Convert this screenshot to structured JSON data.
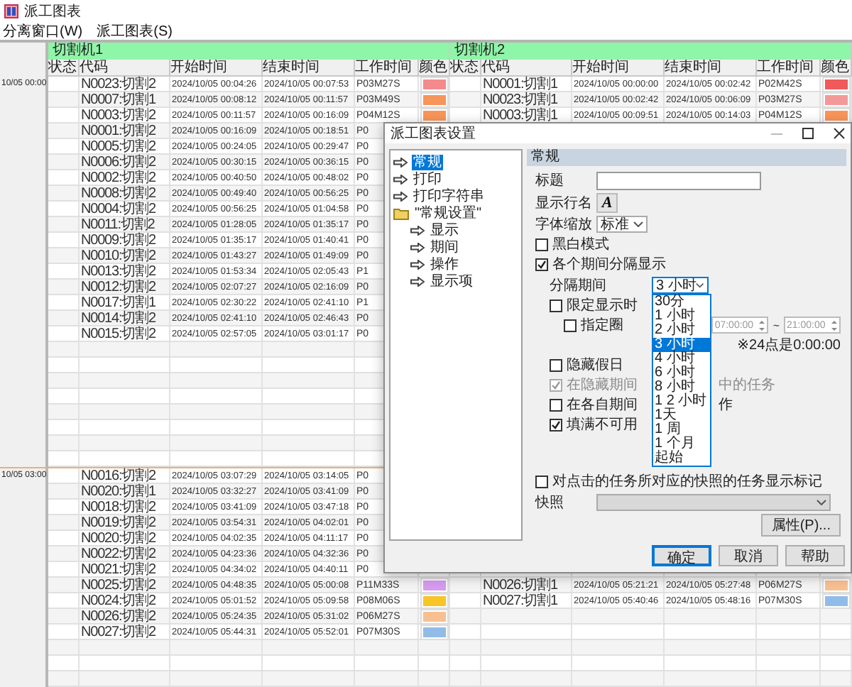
{
  "window": {
    "title": "派工图表"
  },
  "menu": [
    "分离窗口(W)",
    "派工图表(S)"
  ],
  "groups": [
    {
      "title": "切割机1",
      "columns": [
        "状态",
        "代码",
        "开始时间",
        "结束时间",
        "工作时间",
        "颜色"
      ]
    },
    {
      "title": "切割机2",
      "columns": [
        "状态",
        "代码",
        "开始时间",
        "结束时间",
        "工作时间",
        "颜色"
      ]
    }
  ],
  "sections": [
    {
      "time": "10/05 00:00",
      "rows": [
        {
          "left": {
            "code": "N0023:切割2",
            "start": "2024/10/05 00:04:26",
            "end": "2024/10/05 00:07:53",
            "duration": "P03M27S",
            "color": "#f48a8c"
          },
          "right": {
            "code": "N0001:切割1",
            "start": "2024/10/05 00:00:00",
            "end": "2024/10/05 00:02:42",
            "duration": "P02M42S",
            "color": "#f05a5a"
          }
        },
        {
          "left": {
            "code": "N0007:切割1",
            "start": "2024/10/05 00:08:12",
            "end": "2024/10/05 00:11:57",
            "duration": "P03M49S",
            "color": "#f8955a"
          },
          "right": {
            "code": "N0023:切割1",
            "start": "2024/10/05 00:02:42",
            "end": "2024/10/05 00:06:09",
            "duration": "P03M27S",
            "color": "#f4999a"
          }
        },
        {
          "left": {
            "code": "N0003:切割2",
            "start": "2024/10/05 00:11:57",
            "end": "2024/10/05 00:16:09",
            "duration": "P04M12S",
            "color": "#f8955a"
          },
          "right": {
            "code": "N0003:切割1",
            "start": "2024/10/05 00:09:51",
            "end": "2024/10/05 00:14:03",
            "duration": "P04M12S",
            "color": "#f8955a"
          }
        },
        {
          "left": {
            "code": "N0001:切割2",
            "start": "2024/10/05 00:16:09",
            "end": "2024/10/05 00:18:51",
            "duration": "P0"
          }
        },
        {
          "left": {
            "code": "N0005:切割2",
            "start": "2024/10/05 00:24:05",
            "end": "2024/10/05 00:29:47",
            "duration": "P0"
          }
        },
        {
          "left": {
            "code": "N0006:切割2",
            "start": "2024/10/05 00:30:15",
            "end": "2024/10/05 00:36:15",
            "duration": "P0"
          }
        },
        {
          "left": {
            "code": "N0002:切割2",
            "start": "2024/10/05 00:40:50",
            "end": "2024/10/05 00:48:02",
            "duration": "P0"
          }
        },
        {
          "left": {
            "code": "N0008:切割2",
            "start": "2024/10/05 00:49:40",
            "end": "2024/10/05 00:56:25",
            "duration": "P0"
          }
        },
        {
          "left": {
            "code": "N0004:切割2",
            "start": "2024/10/05 00:56:25",
            "end": "2024/10/05 01:04:58",
            "duration": "P0"
          }
        },
        {
          "left": {
            "code": "N0011:切割2",
            "start": "2024/10/05 01:28:05",
            "end": "2024/10/05 01:35:17",
            "duration": "P0"
          }
        },
        {
          "left": {
            "code": "N0009:切割2",
            "start": "2024/10/05 01:35:17",
            "end": "2024/10/05 01:40:41",
            "duration": "P0"
          }
        },
        {
          "left": {
            "code": "N0010:切割2",
            "start": "2024/10/05 01:43:27",
            "end": "2024/10/05 01:49:09",
            "duration": "P0"
          }
        },
        {
          "left": {
            "code": "N0013:切割2",
            "start": "2024/10/05 01:53:34",
            "end": "2024/10/05 02:05:43",
            "duration": "P1"
          }
        },
        {
          "left": {
            "code": "N0012:切割2",
            "start": "2024/10/05 02:07:27",
            "end": "2024/10/05 02:16:09",
            "duration": "P0"
          }
        },
        {
          "left": {
            "code": "N0017:切割1",
            "start": "2024/10/05 02:30:22",
            "end": "2024/10/05 02:41:10",
            "duration": "P1"
          }
        },
        {
          "left": {
            "code": "N0014:切割2",
            "start": "2024/10/05 02:41:10",
            "end": "2024/10/05 02:46:43",
            "duration": "P0"
          }
        },
        {
          "left": {
            "code": "N0015:切割2",
            "start": "2024/10/05 02:57:05",
            "end": "2024/10/05 03:01:17",
            "duration": "P0"
          }
        }
      ]
    },
    {
      "time": "10/05 03:00",
      "rows": [
        {
          "left": {
            "code": "N0016:切割2",
            "start": "2024/10/05 03:07:29",
            "end": "2024/10/05 03:14:05",
            "duration": "P0"
          }
        },
        {
          "left": {
            "code": "N0020:切割1",
            "start": "2024/10/05 03:32:27",
            "end": "2024/10/05 03:41:09",
            "duration": "P0"
          }
        },
        {
          "left": {
            "code": "N0018:切割2",
            "start": "2024/10/05 03:41:09",
            "end": "2024/10/05 03:47:18",
            "duration": "P0"
          }
        },
        {
          "left": {
            "code": "N0019:切割2",
            "start": "2024/10/05 03:54:31",
            "end": "2024/10/05 04:02:01",
            "duration": "P0"
          }
        },
        {
          "left": {
            "code": "N0020:切割2",
            "start": "2024/10/05 04:02:35",
            "end": "2024/10/05 04:11:17",
            "duration": "P0"
          }
        },
        {
          "left": {
            "code": "N0022:切割2",
            "start": "2024/10/05 04:23:36",
            "end": "2024/10/05 04:32:36",
            "duration": "P0"
          }
        },
        {
          "left": {
            "code": "N0021:切割2",
            "start": "2024/10/05 04:34:02",
            "end": "2024/10/05 04:40:11",
            "duration": "P0"
          }
        },
        {
          "left": {
            "code": "N0025:切割2",
            "start": "2024/10/05 04:48:35",
            "end": "2024/10/05 05:00:08",
            "duration": "P11M33S",
            "color": "#d69cf0"
          },
          "right": {
            "code": "N0026:切割1",
            "start": "2024/10/05 05:21:21",
            "end": "2024/10/05 05:27:48",
            "duration": "P06M27S",
            "color": "#f8c092"
          }
        },
        {
          "left": {
            "code": "N0024:切割2",
            "start": "2024/10/05 05:01:52",
            "end": "2024/10/05 05:09:58",
            "duration": "P08M06S",
            "color": "#f8c428"
          },
          "right": {
            "code": "N0027:切割1",
            "start": "2024/10/05 05:40:46",
            "end": "2024/10/05 05:48:16",
            "duration": "P07M30S",
            "color": "#92bce8"
          }
        },
        {
          "left": {
            "code": "N0026:切割2",
            "start": "2024/10/05 05:24:35",
            "end": "2024/10/05 05:31:02",
            "duration": "P06M27S",
            "color": "#f8c092"
          }
        },
        {
          "left": {
            "code": "N0027:切割2",
            "start": "2024/10/05 05:44:31",
            "end": "2024/10/05 05:52:01",
            "duration": "P07M30S",
            "color": "#92bce8"
          }
        }
      ]
    }
  ],
  "dialog": {
    "title": "派工图表设置",
    "tree": [
      {
        "label": "常规",
        "selected": true
      },
      {
        "label": "打印",
        "selected": false
      },
      {
        "label": "打印字符串",
        "selected": false
      },
      {
        "label": "\"常规设置\"",
        "selected": false,
        "children": [
          {
            "label": "显示",
            "selected": false
          },
          {
            "label": "期间",
            "selected": false
          },
          {
            "label": "操作",
            "selected": false
          },
          {
            "label": "显示项",
            "selected": false
          }
        ]
      }
    ],
    "section_title": "常规",
    "title_field": {
      "label": "标题"
    },
    "row_name": {
      "label": "显示行名",
      "button": "A"
    },
    "font_scale": {
      "label": "字体缩放",
      "value": "标准"
    },
    "mono_mode": {
      "label": "黑白模式",
      "checked": false
    },
    "split_display": {
      "label": "各个期间分隔显示",
      "checked": true
    },
    "split_period": {
      "label": "分隔期间",
      "value": "3 小时",
      "expanded": true,
      "options": [
        {
          "label": "30分",
          "selected": false
        },
        {
          "label": "1 小时",
          "selected": false
        },
        {
          "label": "2 小时",
          "selected": false
        },
        {
          "label": "3 小时",
          "selected": true
        },
        {
          "label": "4 小时",
          "selected": false
        },
        {
          "label": "6 小时",
          "selected": false
        },
        {
          "label": "8 小时",
          "selected": false
        },
        {
          "label": "1 2 小时",
          "selected": false
        },
        {
          "label": "1天",
          "selected": false
        },
        {
          "label": "1 周",
          "selected": false
        },
        {
          "label": "1 个月",
          "selected": false
        },
        {
          "label": "起始",
          "selected": false
        }
      ]
    },
    "limit_display": {
      "label": "限定显示时",
      "checked": false
    },
    "range": {
      "label": "指定圈",
      "checked": false,
      "from": "07:00:00",
      "separator": "~",
      "to": "21:00:00",
      "note": "※24点是0:00:00"
    },
    "hide_holidays": {
      "label": "隐藏假日",
      "checked": false
    },
    "hidden_tasks": {
      "label_start": "在隐藏期间",
      "label_end": "中的任务",
      "checked": true,
      "disabled": true
    },
    "each_period": {
      "label_start": "在各自期间",
      "label_end": "作",
      "checked": false,
      "disabled": false
    },
    "fill_unavailable": {
      "label": "填满不可用",
      "checked": true
    },
    "mark_snapshot": {
      "label": "对点击的任务所对应的快照的任务显示标记",
      "checked": false
    },
    "snapshot": {
      "label": "快照",
      "disabled": true
    },
    "properties_button": "属性(P)...",
    "buttons": [
      {
        "label": "确定",
        "default": true
      },
      {
        "label": "取消",
        "default": false
      },
      {
        "label": "帮助",
        "default": false
      }
    ]
  }
}
